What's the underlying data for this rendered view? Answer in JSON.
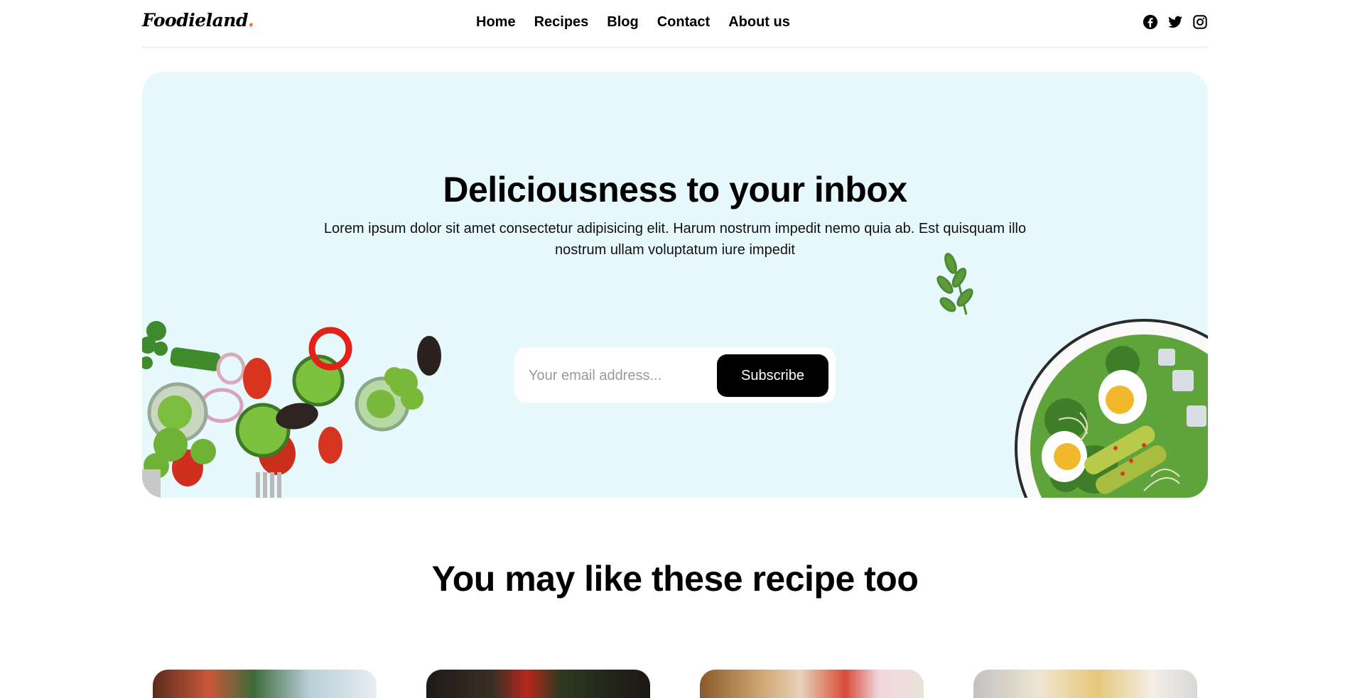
{
  "brand": {
    "name": "Foodieland",
    "dot": "."
  },
  "nav": {
    "items": [
      "Home",
      "Recipes",
      "Blog",
      "Contact",
      "About us"
    ]
  },
  "social": [
    "facebook-icon",
    "twitter-icon",
    "instagram-icon"
  ],
  "newsletter": {
    "title": "Deliciousness to your inbox",
    "description": "Lorem ipsum dolor sit amet consectetur adipisicing elit. Harum nostrum impedit nemo quia ab. Est quisquam illo nostrum ullam voluptatum iure impedit",
    "email_placeholder": "Your email address...",
    "subscribe_label": "Subscribe"
  },
  "recommendations": {
    "title": "You may like these recipe too"
  },
  "colors": {
    "hero_bg": "#e7f9fd",
    "accent": "#ff6b1a",
    "button_bg": "#000000"
  }
}
